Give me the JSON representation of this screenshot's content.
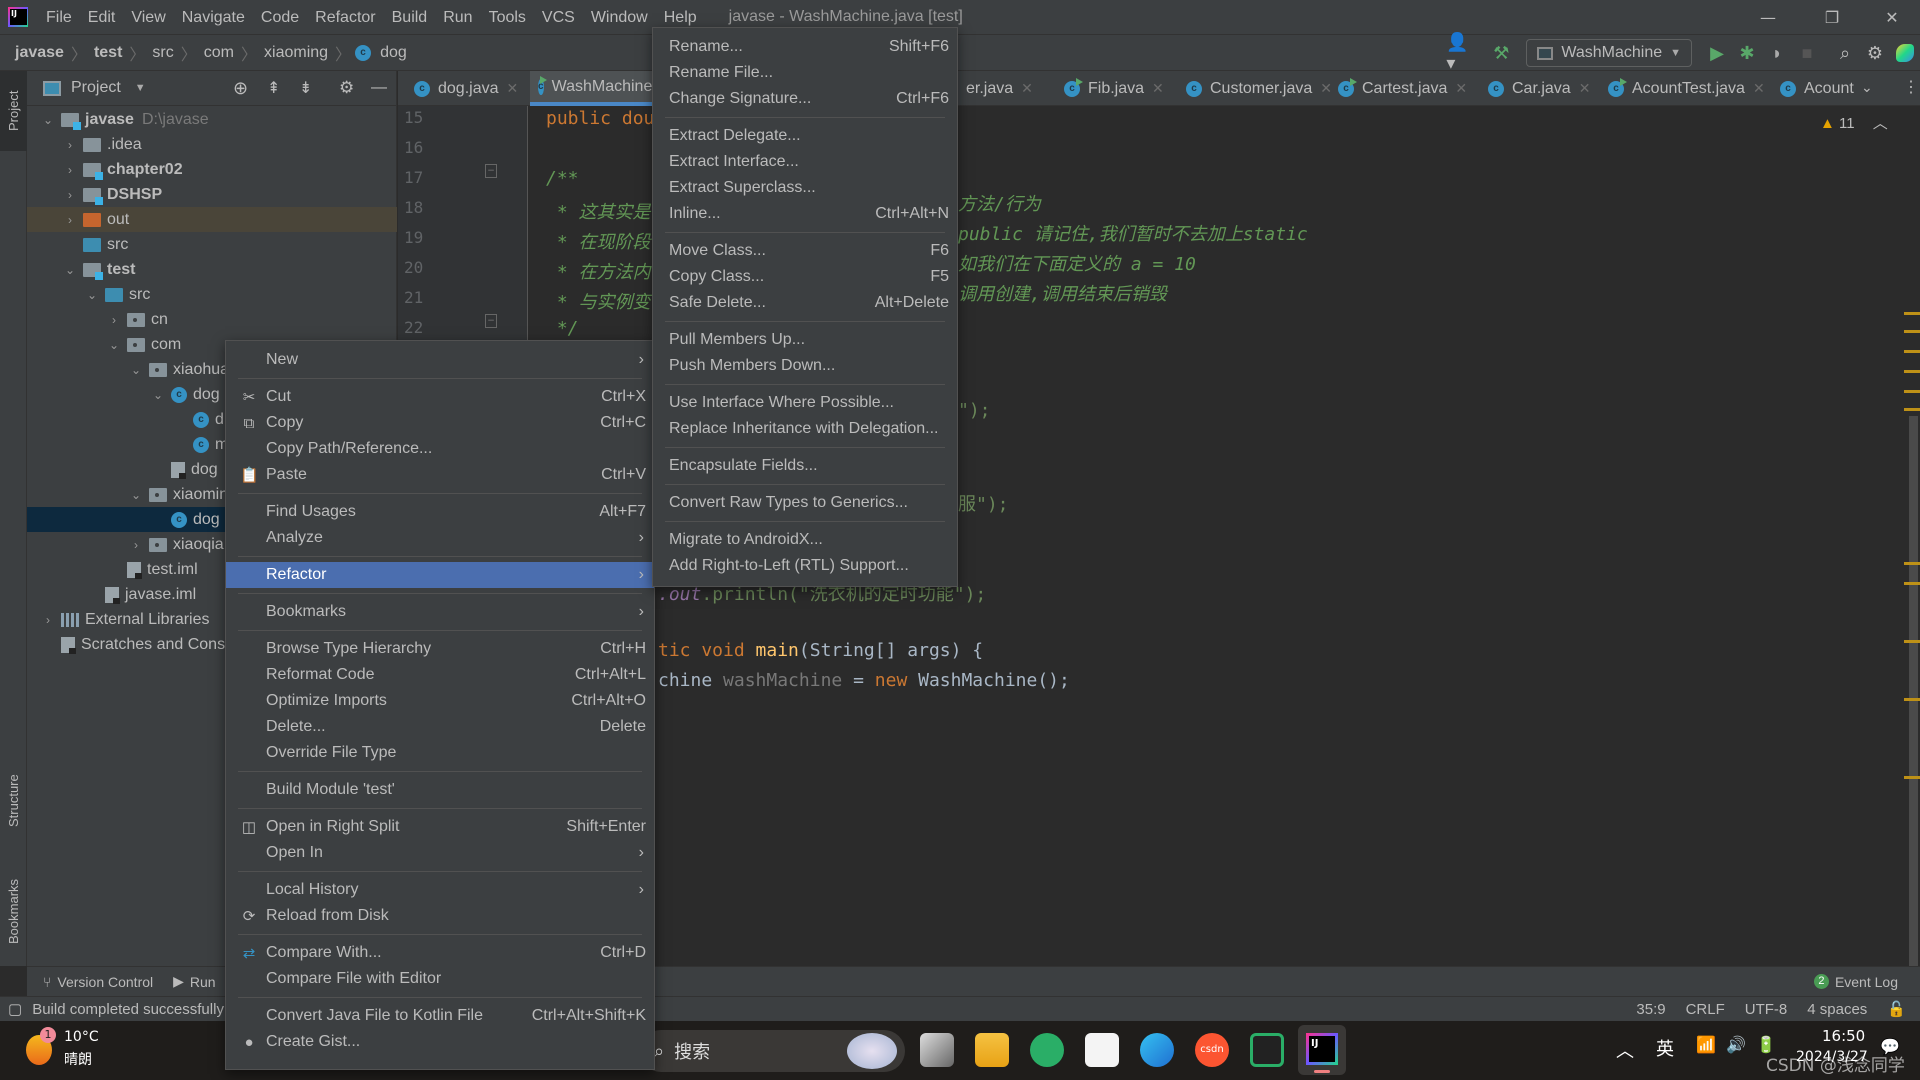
{
  "titlebar": {
    "menus": [
      "File",
      "Edit",
      "View",
      "Navigate",
      "Code",
      "Refactor",
      "Build",
      "Run",
      "Tools",
      "VCS",
      "Window",
      "Help"
    ],
    "window_title": "javase - WashMachine.java [test]",
    "controls": {
      "minimize": "—",
      "restore": "❐",
      "close": "✕"
    }
  },
  "breadcrumb": [
    "javase",
    "test",
    "src",
    "com",
    "xiaoming",
    "dog"
  ],
  "toolbar": {
    "run_config": "WashMachine",
    "icons": [
      "user-icon",
      "build-hammer-icon",
      "run-icon",
      "debug-icon",
      "coverage-icon",
      "stop-icon",
      "search-icon",
      "settings-icon",
      "toolbox-icon"
    ]
  },
  "side_tabs": {
    "project": "Project",
    "structure": "Structure",
    "bookmarks": "Bookmarks"
  },
  "project_panel": {
    "title": "Project",
    "tree": [
      {
        "label": "javase",
        "hint": "D:\\javase",
        "bold": true,
        "depth": 0,
        "expanded": true,
        "icon": "module-folder"
      },
      {
        "label": ".idea",
        "depth": 1,
        "collapsed": true,
        "icon": "folder"
      },
      {
        "label": "chapter02",
        "bold": true,
        "depth": 1,
        "collapsed": true,
        "icon": "module-folder"
      },
      {
        "label": "DSHSP",
        "bold": true,
        "depth": 1,
        "collapsed": true,
        "icon": "module-folder"
      },
      {
        "label": "out",
        "depth": 1,
        "collapsed": true,
        "icon": "excluded-folder",
        "state": "excluded"
      },
      {
        "label": "src",
        "depth": 1,
        "icon": "source-folder"
      },
      {
        "label": "test",
        "bold": true,
        "depth": 1,
        "expanded": true,
        "icon": "module-folder"
      },
      {
        "label": "src",
        "depth": 2,
        "expanded": true,
        "icon": "source-folder"
      },
      {
        "label": "cn",
        "depth": 3,
        "collapsed": true,
        "icon": "package"
      },
      {
        "label": "com",
        "depth": 3,
        "expanded": true,
        "icon": "package"
      },
      {
        "label": "xiaohua",
        "depth": 4,
        "expanded": true,
        "icon": "package"
      },
      {
        "label": "dog",
        "depth": 5,
        "expanded": true,
        "icon": "class"
      },
      {
        "label": "d",
        "depth": 6,
        "icon": "class"
      },
      {
        "label": "m",
        "depth": 6,
        "icon": "class"
      },
      {
        "label": "dog",
        "depth": 5,
        "icon": "java-file"
      },
      {
        "label": "xiaoming",
        "depth": 4,
        "expanded": true,
        "icon": "package"
      },
      {
        "label": "dog",
        "depth": 5,
        "icon": "class",
        "state": "selected"
      },
      {
        "label": "xiaoqia",
        "depth": 4,
        "collapsed": true,
        "icon": "package"
      },
      {
        "label": "test.iml",
        "depth": 3,
        "icon": "iml-file"
      },
      {
        "label": "javase.iml",
        "depth": 2,
        "icon": "iml-file"
      },
      {
        "label": "External Libraries",
        "depth": 0,
        "collapsed": true,
        "icon": "library"
      },
      {
        "label": "Scratches and Consoles",
        "depth": 0,
        "icon": "scratches"
      }
    ]
  },
  "editor_tabs": [
    {
      "label": "dog.java",
      "icon": "class"
    },
    {
      "label": "WashMachine.java",
      "icon": "class-run",
      "active": true
    },
    {
      "label": "er.java",
      "icon": "none"
    },
    {
      "label": "Fib.java",
      "icon": "class-run"
    },
    {
      "label": "Customer.java",
      "icon": "class"
    },
    {
      "label": "Cartest.java",
      "icon": "class-run"
    },
    {
      "label": "Car.java",
      "icon": "class"
    },
    {
      "label": "AcountTest.java",
      "icon": "class-run"
    },
    {
      "label": "Acount",
      "icon": "class"
    }
  ],
  "editor": {
    "warnings": "11",
    "line_numbers": [
      "15",
      "16",
      "17",
      "18",
      "19",
      "20",
      "21",
      "22"
    ],
    "lines_left": [
      {
        "t": "public dou",
        "c": "kw"
      },
      {
        "t": "",
        "c": ""
      },
      {
        "t": "/**",
        "c": "cm"
      },
      {
        "t": " * 这其实是",
        "c": "cm"
      },
      {
        "t": " * 在现阶段",
        "c": "cm"
      },
      {
        "t": " * 在方法内",
        "c": "cm"
      },
      {
        "t": " * 与实例变",
        "c": "cm"
      },
      {
        "t": " */",
        "c": "cm"
      }
    ],
    "lines_right": [
      "方法/行为",
      "public 请记住,我们暂时不去加上static",
      "如我们在下面定义的 a = 10",
      "调用创建,调用结束后销毁"
    ],
    "line_a": "\");",
    "line_b": "服\");",
    "line_c_out": ".out",
    "line_c_rest": ".println(\"洗衣机的定时功能\");",
    "main_kw": "tic void ",
    "main_fn": "main",
    "main_rest": "(String[] args) {",
    "decl_type": "chine ",
    "decl_var": "washMachine",
    "decl_eq": " = ",
    "decl_new": "new ",
    "decl_ctor": "WashMachine();"
  },
  "context_menu": [
    {
      "label": "New",
      "submenu": true
    },
    {
      "sep": true
    },
    {
      "label": "Cut",
      "shortcut": "Ctrl+X",
      "icon": "cut-icon"
    },
    {
      "label": "Copy",
      "shortcut": "Ctrl+C",
      "icon": "copy-icon"
    },
    {
      "label": "Copy Path/Reference..."
    },
    {
      "label": "Paste",
      "shortcut": "Ctrl+V",
      "icon": "paste-icon"
    },
    {
      "sep": true
    },
    {
      "label": "Find Usages",
      "shortcut": "Alt+F7"
    },
    {
      "label": "Analyze",
      "submenu": true
    },
    {
      "sep": true
    },
    {
      "label": "Refactor",
      "submenu": true,
      "highlighted": true
    },
    {
      "sep": true
    },
    {
      "label": "Bookmarks",
      "submenu": true
    },
    {
      "sep": true
    },
    {
      "label": "Browse Type Hierarchy",
      "shortcut": "Ctrl+H"
    },
    {
      "label": "Reformat Code",
      "shortcut": "Ctrl+Alt+L"
    },
    {
      "label": "Optimize Imports",
      "shortcut": "Ctrl+Alt+O"
    },
    {
      "label": "Delete...",
      "shortcut": "Delete"
    },
    {
      "label": "Override File Type"
    },
    {
      "sep": true
    },
    {
      "label": "Build Module 'test'"
    },
    {
      "sep": true
    },
    {
      "label": "Open in Right Split",
      "shortcut": "Shift+Enter",
      "icon": "split-icon"
    },
    {
      "label": "Open In",
      "submenu": true
    },
    {
      "sep": true
    },
    {
      "label": "Local History",
      "submenu": true
    },
    {
      "label": "Reload from Disk",
      "icon": "reload-icon"
    },
    {
      "sep": true
    },
    {
      "label": "Compare With...",
      "shortcut": "Ctrl+D",
      "icon": "compare-icon"
    },
    {
      "label": "Compare File with Editor"
    },
    {
      "sep": true
    },
    {
      "label": "Convert Java File to Kotlin File",
      "shortcut": "Ctrl+Alt+Shift+K"
    },
    {
      "label": "Create Gist...",
      "icon": "github-icon"
    }
  ],
  "refactor_menu": [
    {
      "label": "Rename...",
      "shortcut": "Shift+F6"
    },
    {
      "label": "Rename File..."
    },
    {
      "label": "Change Signature...",
      "shortcut": "Ctrl+F6"
    },
    {
      "sep": true
    },
    {
      "label": "Extract Delegate..."
    },
    {
      "label": "Extract Interface..."
    },
    {
      "label": "Extract Superclass..."
    },
    {
      "label": "Inline...",
      "shortcut": "Ctrl+Alt+N"
    },
    {
      "sep": true
    },
    {
      "label": "Move Class...",
      "shortcut": "F6"
    },
    {
      "label": "Copy Class...",
      "shortcut": "F5"
    },
    {
      "label": "Safe Delete...",
      "shortcut": "Alt+Delete"
    },
    {
      "sep": true
    },
    {
      "label": "Pull Members Up..."
    },
    {
      "label": "Push Members Down..."
    },
    {
      "sep": true
    },
    {
      "label": "Use Interface Where Possible..."
    },
    {
      "label": "Replace Inheritance with Delegation..."
    },
    {
      "sep": true
    },
    {
      "label": "Encapsulate Fields..."
    },
    {
      "sep": true
    },
    {
      "label": "Convert Raw Types to Generics..."
    },
    {
      "sep": true
    },
    {
      "label": "Migrate to AndroidX..."
    },
    {
      "label": "Add Right-to-Left (RTL) Support..."
    }
  ],
  "bottom_tools": {
    "version_control": "Version Control",
    "run": "Run",
    "event_log": "Event Log",
    "event_count": "2"
  },
  "status": {
    "message": "Build completed successfully",
    "position": "35:9",
    "line_sep": "CRLF",
    "encoding": "UTF-8",
    "indent": "4 spaces"
  },
  "taskbar": {
    "weather_temp": "10°C",
    "weather_desc": "晴朗",
    "weather_badge": "1",
    "search_placeholder": "搜索",
    "ime": "英",
    "time": "16:50",
    "date": "2024/3/27",
    "watermark": "CSDN @浅念同学"
  },
  "colors": {
    "accent": "#4b6eaf",
    "tab_underline": "#4a88c7",
    "selection": "#0d293e"
  }
}
